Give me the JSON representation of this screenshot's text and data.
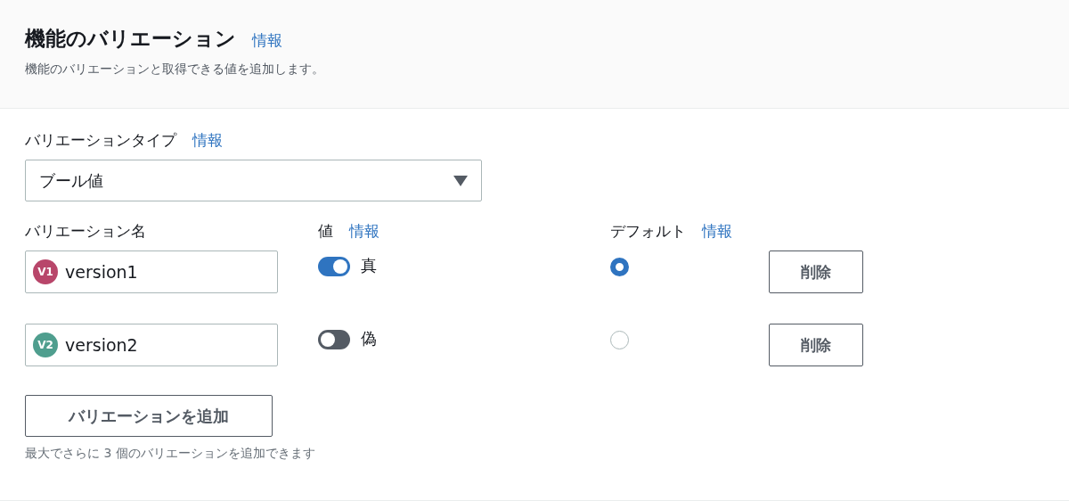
{
  "header": {
    "title": "機能のバリエーション",
    "info_link": "情報",
    "description": "機能のバリエーションと取得できる値を追加します。"
  },
  "variation_type": {
    "label": "バリエーションタイプ",
    "info_link": "情報",
    "value": "ブール値"
  },
  "columns": {
    "name": {
      "label": "バリエーション名"
    },
    "value": {
      "label": "値",
      "info_link": "情報"
    },
    "default": {
      "label": "デフォルト",
      "info_link": "情報"
    }
  },
  "variations": [
    {
      "badge": "V1",
      "color": "#b8466a",
      "name": "version1",
      "on": true,
      "value_label": "真",
      "selected": true,
      "delete_label": "削除"
    },
    {
      "badge": "V2",
      "color": "#4f9e8e",
      "name": "version2",
      "on": false,
      "value_label": "偽",
      "selected": false,
      "delete_label": "削除"
    }
  ],
  "add_button": "バリエーションを追加",
  "hint": "最大でさらに 3 個のバリエーションを追加できます"
}
